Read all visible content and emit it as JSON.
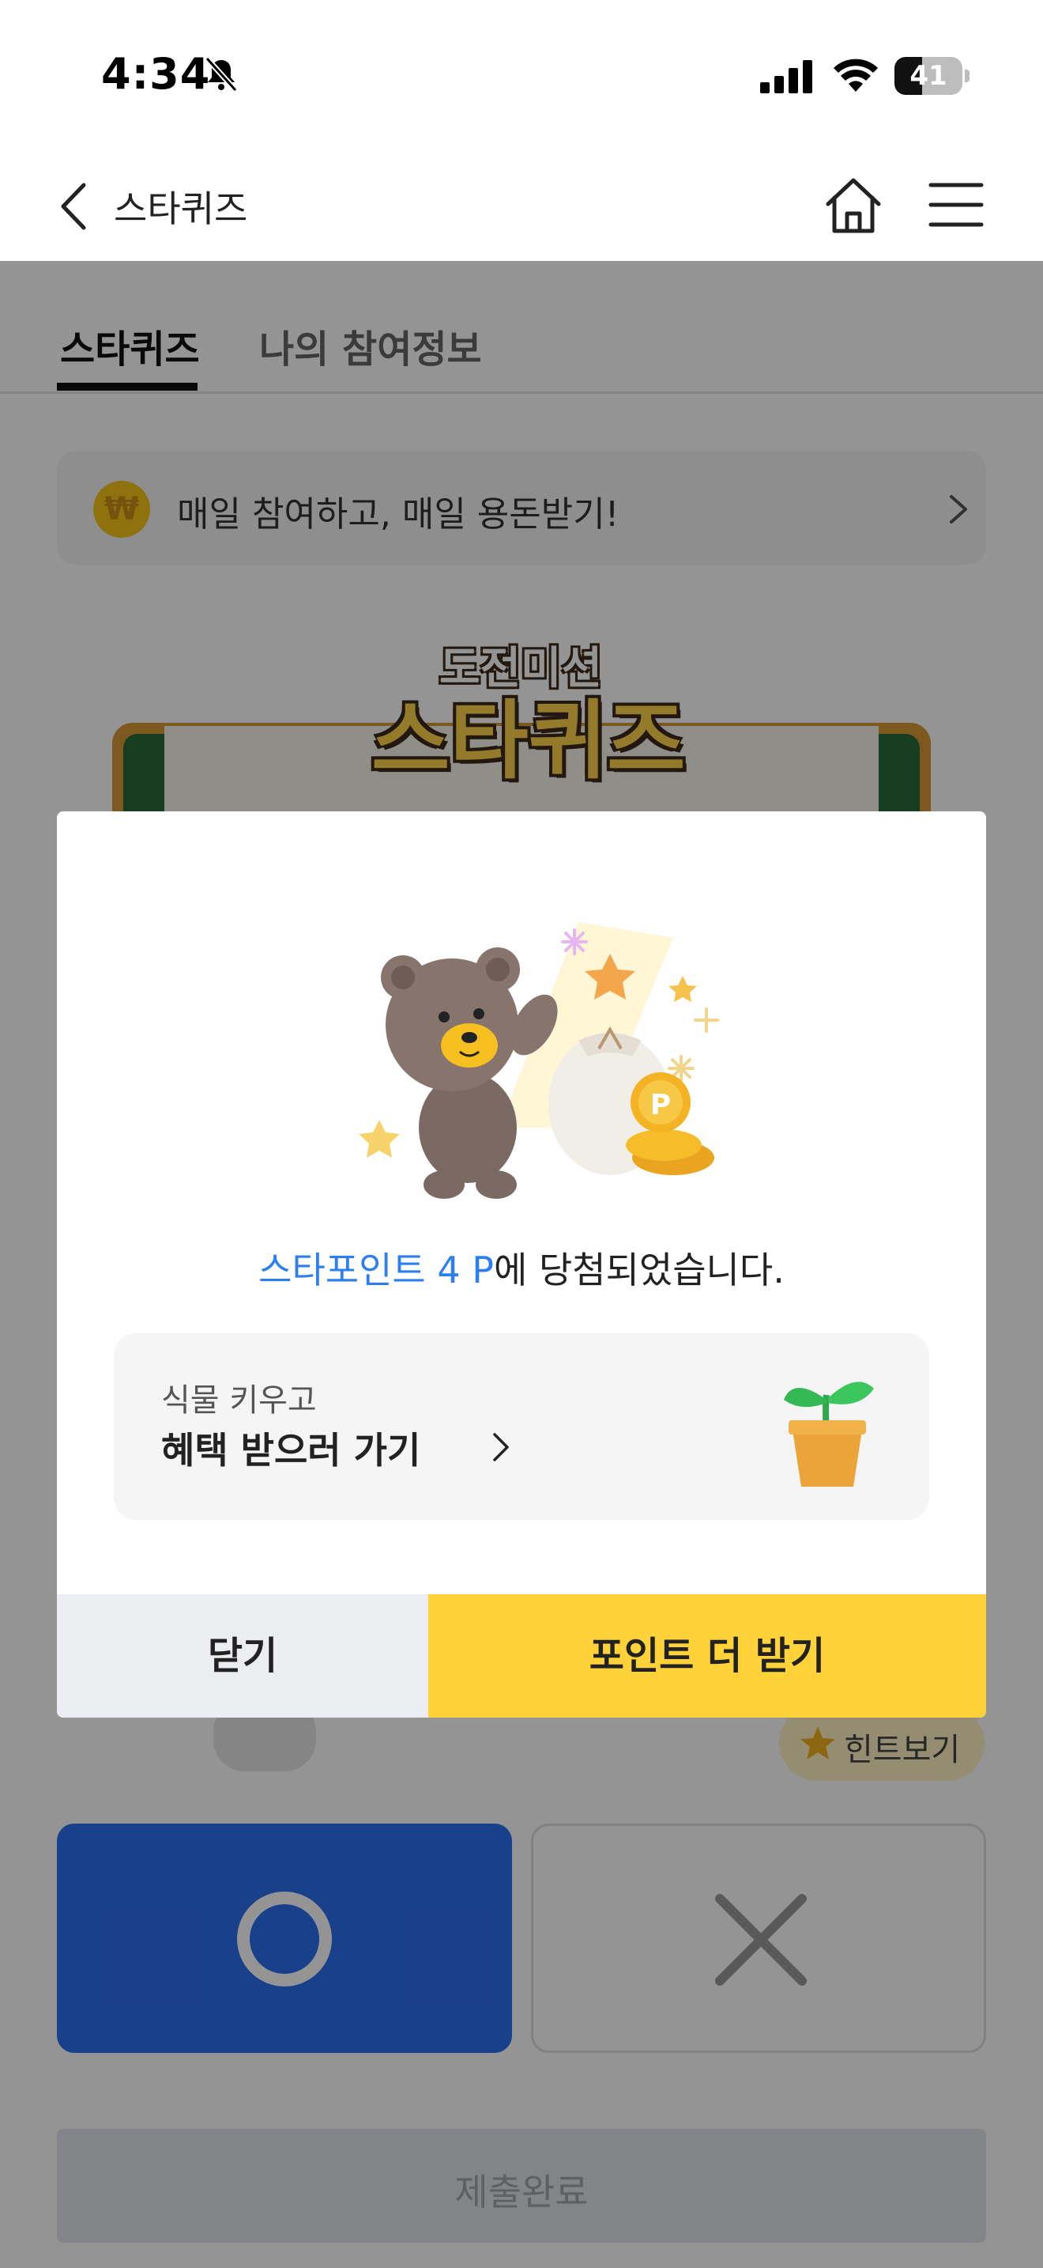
{
  "status_bar": {
    "time": "4:34",
    "battery": "41",
    "battery_level": 0.41
  },
  "header": {
    "title": "스타퀴즈",
    "back_icon": "chevron-left-icon",
    "home_icon": "home-icon",
    "menu_icon": "hamburger-menu-icon"
  },
  "tabs": [
    {
      "label": "스타퀴즈",
      "active": true
    },
    {
      "label": "나의 참여정보",
      "active": false
    }
  ],
  "banner": {
    "icon": "won-coin-icon",
    "text": "매일 참여하고, 매일 용돈받기!"
  },
  "quiz": {
    "logo_top": "도전미션",
    "logo_main": "스타퀴즈",
    "hint_label": "힌트보기",
    "submit_label": "제출완료"
  },
  "modal": {
    "result_highlight": "스타포인트 4 P",
    "result_suffix": "에 당첨되었습니다.",
    "benefit_small": "식물 키우고",
    "benefit_main": "혜택 받으러 가기",
    "close_label": "닫기",
    "more_label": "포인트 더 받기"
  },
  "colors": {
    "accent_blue": "#2d7ff0",
    "answer_o_blue": "#2c6ef0",
    "primary_yellow": "#ffd23a",
    "close_grey": "#ebedf0"
  }
}
